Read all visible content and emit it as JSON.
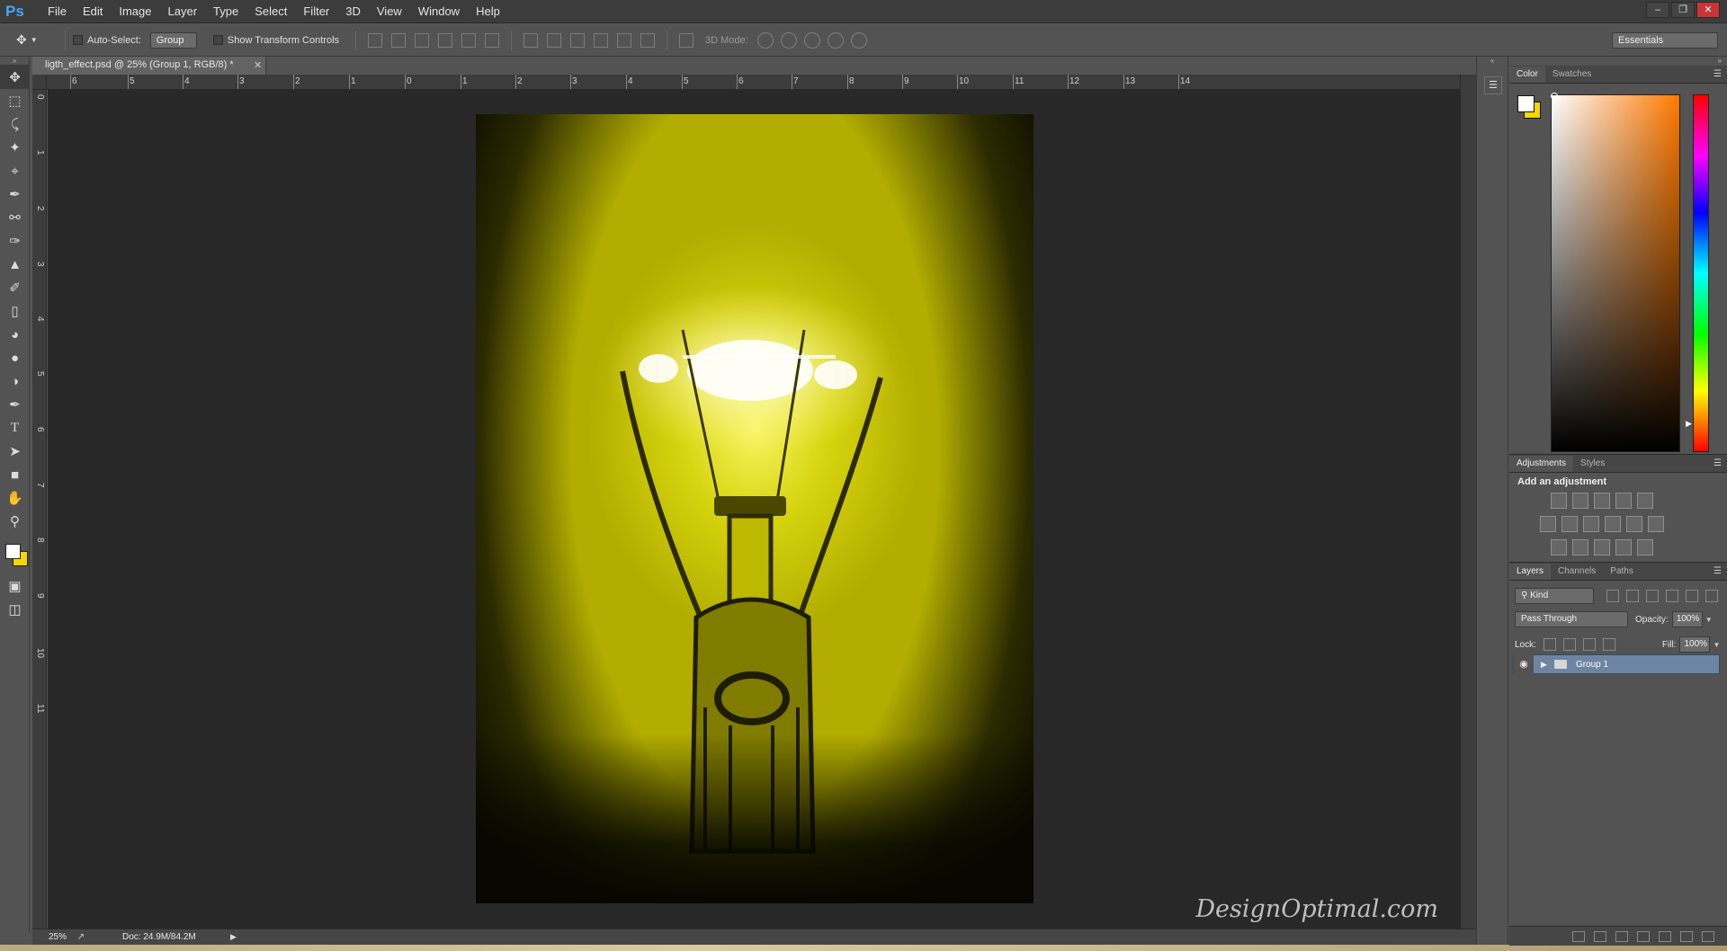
{
  "app": {
    "logo": "Ps",
    "menu": [
      "File",
      "Edit",
      "Image",
      "Layer",
      "Type",
      "Select",
      "Filter",
      "3D",
      "View",
      "Window",
      "Help"
    ]
  },
  "options_bar": {
    "auto_select_label": "Auto-Select:",
    "auto_select_value": "Group",
    "show_transform_label": "Show Transform Controls",
    "mode_3d_label": "3D Mode:",
    "workspace": "Essentials"
  },
  "document": {
    "tab_title": "ligth_effect.psd @ 25% (Group 1, RGB/8) *",
    "zoom": "25%",
    "doc_size": "Doc: 24.9M/84.2M",
    "watermark": "DesignOptimal.com"
  },
  "rulers": {
    "horizontal": [
      "6",
      "5",
      "4",
      "3",
      "2",
      "1",
      "0",
      "1",
      "2",
      "3",
      "4",
      "5",
      "6",
      "7",
      "8",
      "9",
      "10",
      "11",
      "12",
      "13",
      "14"
    ],
    "vertical": [
      "0",
      "1",
      "2",
      "3",
      "4",
      "5",
      "6",
      "7",
      "8",
      "9",
      "10",
      "11"
    ]
  },
  "colors": {
    "foreground": "#ffffff",
    "background": "#f5d800"
  },
  "color_panel": {
    "tabs": [
      "Color",
      "Swatches"
    ]
  },
  "adjustments_panel": {
    "tabs": [
      "Adjustments",
      "Styles"
    ],
    "title": "Add an adjustment"
  },
  "layers_panel": {
    "tabs": [
      "Layers",
      "Channels",
      "Paths"
    ],
    "filter_kind": "Kind",
    "blend_mode": "Pass Through",
    "opacity_label": "Opacity:",
    "opacity_value": "100%",
    "lock_label": "Lock:",
    "fill_label": "Fill:",
    "fill_value": "100%",
    "layers": [
      {
        "name": "Group 1",
        "type": "group",
        "visible": true,
        "selected": true
      }
    ]
  }
}
